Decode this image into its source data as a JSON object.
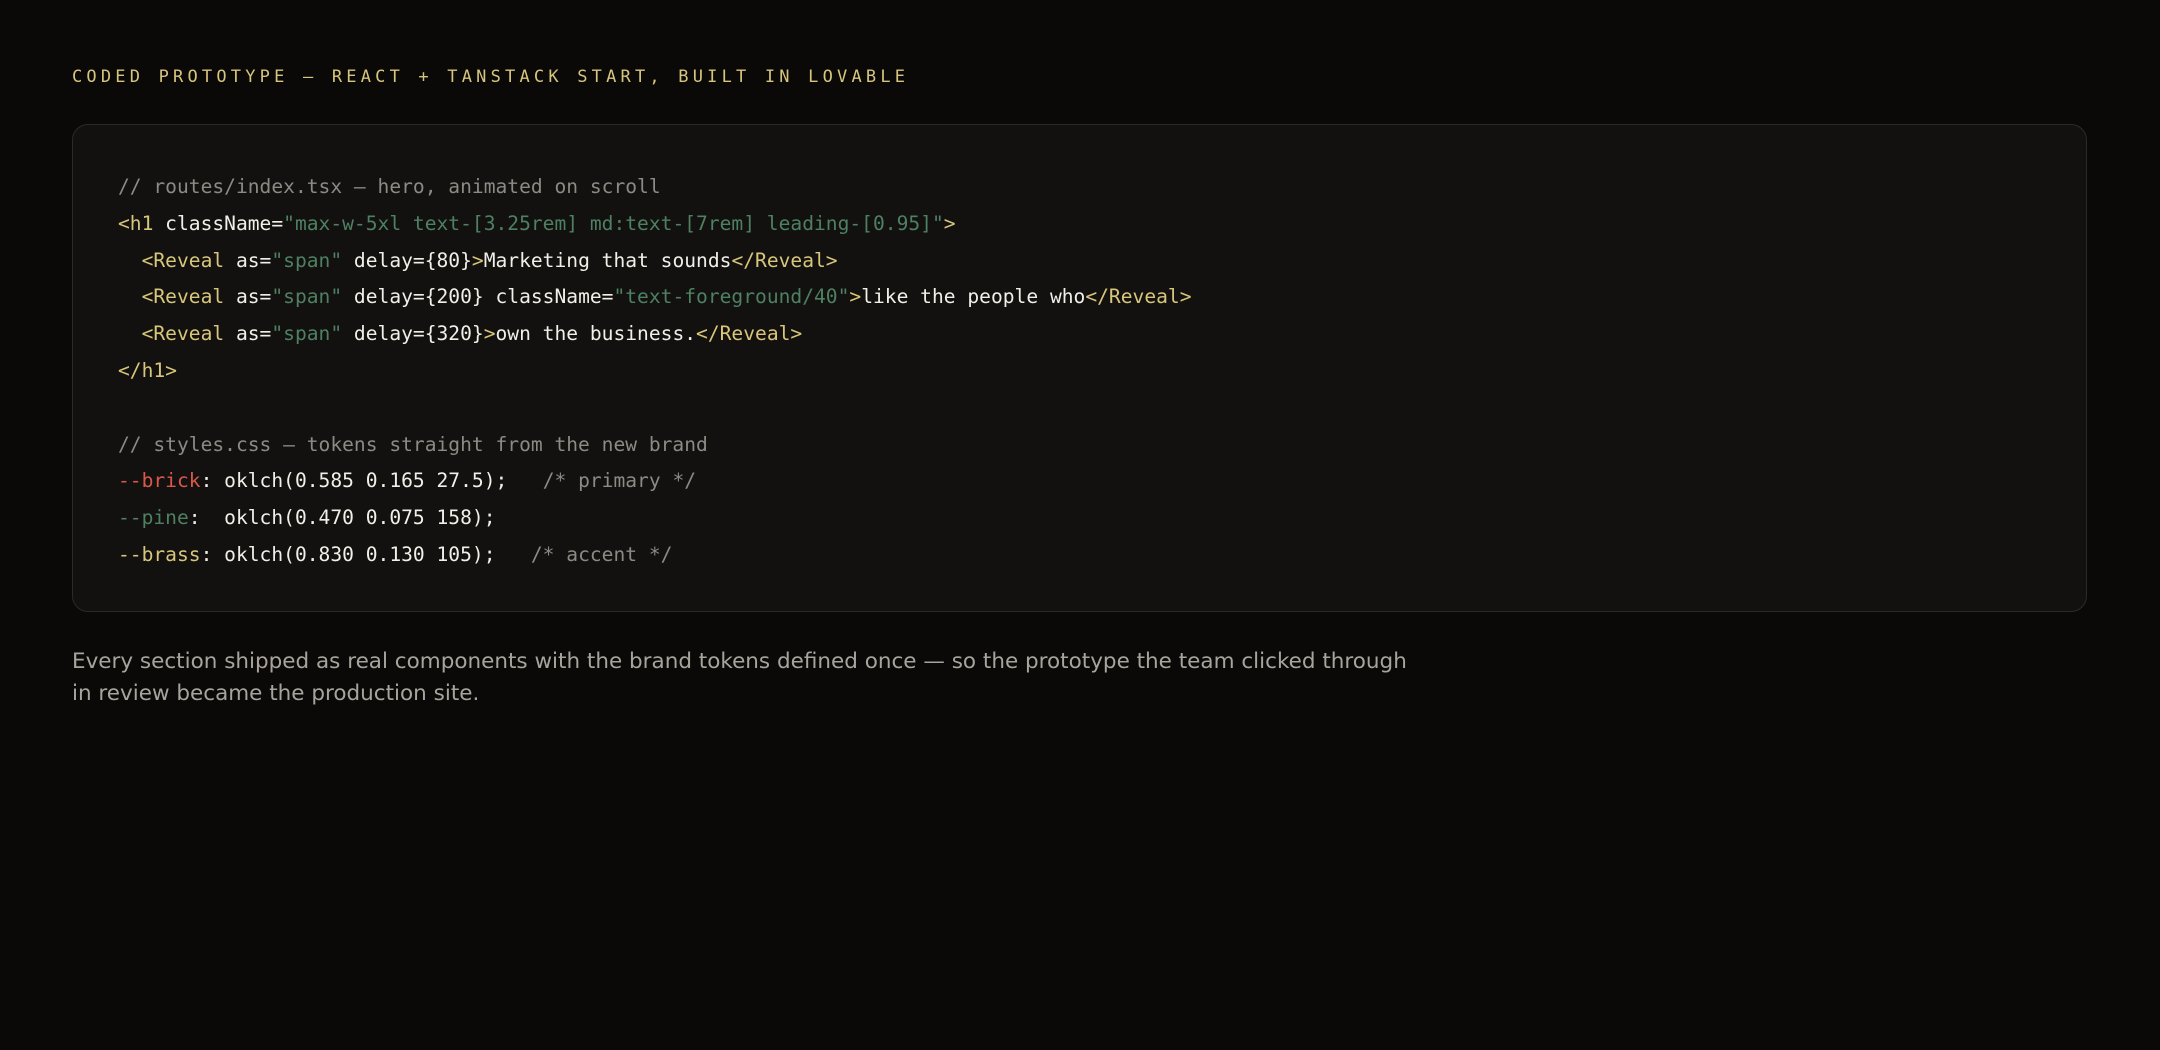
{
  "header": {
    "eyebrow": "CODED PROTOTYPE — REACT + TANSTACK START, BUILT IN LOVABLE"
  },
  "colors": {
    "background": "#0a0908",
    "card": "#121110",
    "comment": "#8d8a84",
    "tag": "#d8c67a",
    "string": "#4e8062",
    "brick": "#d9584a",
    "pine": "#4e8062",
    "brass": "#d8c67a"
  },
  "code_block": {
    "lines": [
      [
        {
          "type": "comment",
          "text": "// routes/index.tsx — hero, animated on scroll"
        }
      ],
      [
        {
          "type": "tag",
          "text": "<h1"
        },
        {
          "type": "plain",
          "text": " className="
        },
        {
          "type": "string",
          "text": "\"max-w-5xl text-[3.25rem] md:text-[7rem] leading-[0.95]\""
        },
        {
          "type": "tag",
          "text": ">"
        }
      ],
      [
        {
          "type": "plain",
          "text": "  "
        },
        {
          "type": "tag",
          "text": "<Reveal"
        },
        {
          "type": "plain",
          "text": " as="
        },
        {
          "type": "string",
          "text": "\"span\""
        },
        {
          "type": "plain",
          "text": " delay={80}"
        },
        {
          "type": "tag",
          "text": ">"
        },
        {
          "type": "plain",
          "text": "Marketing that sounds"
        },
        {
          "type": "tag",
          "text": "</Reveal>"
        }
      ],
      [
        {
          "type": "plain",
          "text": "  "
        },
        {
          "type": "tag",
          "text": "<Reveal"
        },
        {
          "type": "plain",
          "text": " as="
        },
        {
          "type": "string",
          "text": "\"span\""
        },
        {
          "type": "plain",
          "text": " delay={200} className="
        },
        {
          "type": "string",
          "text": "\"text-foreground/40\""
        },
        {
          "type": "tag",
          "text": ">"
        },
        {
          "type": "plain",
          "text": "like the people who"
        },
        {
          "type": "tag",
          "text": "</Reveal>"
        }
      ],
      [
        {
          "type": "plain",
          "text": "  "
        },
        {
          "type": "tag",
          "text": "<Reveal"
        },
        {
          "type": "plain",
          "text": " as="
        },
        {
          "type": "string",
          "text": "\"span\""
        },
        {
          "type": "plain",
          "text": " delay={320}"
        },
        {
          "type": "tag",
          "text": ">"
        },
        {
          "type": "plain",
          "text": "own the business."
        },
        {
          "type": "tag",
          "text": "</Reveal>"
        }
      ],
      [
        {
          "type": "tag",
          "text": "</h1>"
        }
      ],
      [],
      [
        {
          "type": "comment",
          "text": "// styles.css — tokens straight from the new brand"
        }
      ],
      [
        {
          "type": "brick",
          "text": "--brick"
        },
        {
          "type": "plain",
          "text": ": oklch(0.585 0.165 27.5);   "
        },
        {
          "type": "comment",
          "text": "/* primary */"
        }
      ],
      [
        {
          "type": "pine",
          "text": "--pine"
        },
        {
          "type": "plain",
          "text": ":  oklch(0.470 0.075 158);"
        }
      ],
      [
        {
          "type": "brass",
          "text": "--brass"
        },
        {
          "type": "plain",
          "text": ": oklch(0.830 0.130 105);   "
        },
        {
          "type": "comment",
          "text": "/* accent */"
        }
      ]
    ]
  },
  "caption": {
    "text": "Every section shipped as real components with the brand tokens defined once — so the prototype the team clicked through in review became the production site."
  }
}
